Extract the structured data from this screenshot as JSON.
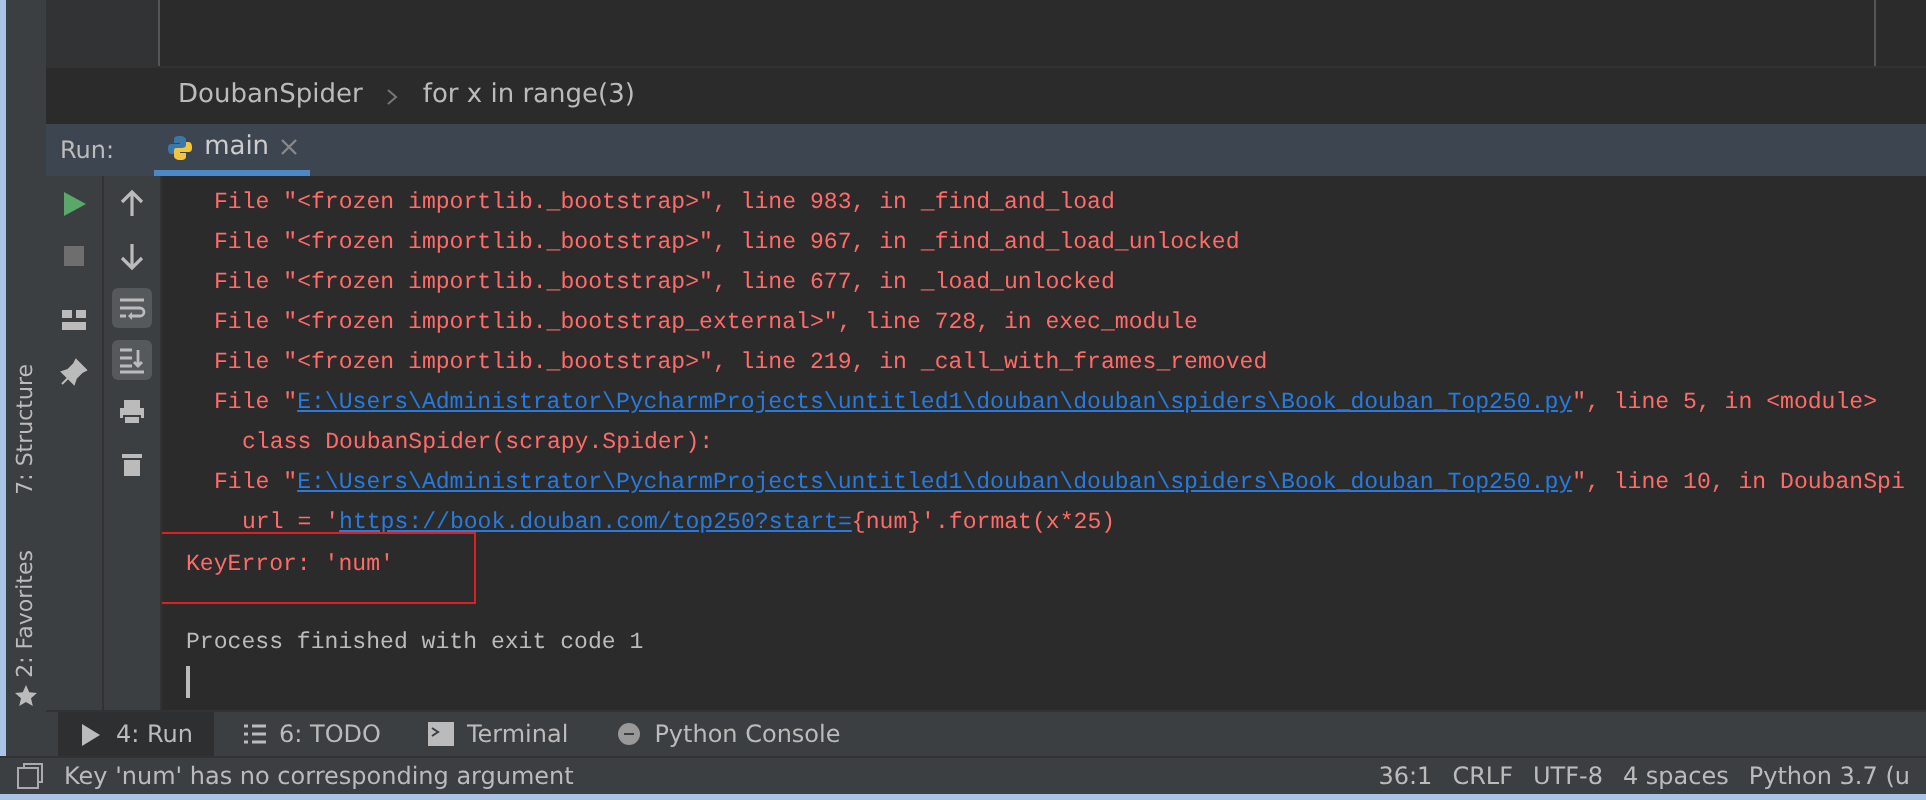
{
  "side_tabs": [
    {
      "label": "7: Structure"
    },
    {
      "label": "2: Favorites"
    }
  ],
  "breadcrumb": [
    {
      "label": "DoubanSpider"
    },
    {
      "label": "for x in range(3)"
    }
  ],
  "run_panel": {
    "title": "Run:",
    "tabs": [
      {
        "label": "main",
        "selected": true
      }
    ]
  },
  "toolbar_left": [
    {
      "kind": "run"
    },
    {
      "kind": "stop"
    },
    {
      "kind": "layout"
    },
    {
      "kind": "pin"
    }
  ],
  "toolbar_right": [
    {
      "kind": "up",
      "on": false
    },
    {
      "kind": "down",
      "on": false
    },
    {
      "kind": "wrap",
      "on": true
    },
    {
      "kind": "scroll-end",
      "on": true
    },
    {
      "kind": "print",
      "on": false
    },
    {
      "kind": "trash",
      "on": false
    }
  ],
  "console": [
    {
      "kind": "frame",
      "parts": [
        {
          "kind": "error",
          "text": "File \"<frozen importlib._bootstrap>\", line 983, in _find_and_load"
        }
      ]
    },
    {
      "kind": "frame",
      "parts": [
        {
          "kind": "error",
          "text": "File \"<frozen importlib._bootstrap>\", line 967, in _find_and_load_unlocked"
        }
      ]
    },
    {
      "kind": "frame",
      "parts": [
        {
          "kind": "error",
          "text": "File \"<frozen importlib._bootstrap>\", line 677, in _load_unlocked"
        }
      ]
    },
    {
      "kind": "frame",
      "parts": [
        {
          "kind": "error",
          "text": "File \"<frozen importlib._bootstrap_external>\", line 728, in exec_module"
        }
      ]
    },
    {
      "kind": "frame",
      "parts": [
        {
          "kind": "error",
          "text": "File \"<frozen importlib._bootstrap>\", line 219, in _call_with_frames_removed"
        }
      ]
    },
    {
      "kind": "frame",
      "parts": [
        {
          "kind": "error",
          "text": "File \""
        },
        {
          "kind": "link",
          "text": "E:\\Users\\Administrator\\PycharmProjects\\untitled1\\douban\\douban\\spiders\\Book_douban_Top250.py"
        },
        {
          "kind": "error",
          "text": "\", line 5, in <module>"
        }
      ]
    },
    {
      "kind": "source",
      "parts": [
        {
          "kind": "error",
          "text": "class DoubanSpider(scrapy.Spider):"
        }
      ]
    },
    {
      "kind": "frame",
      "parts": [
        {
          "kind": "error",
          "text": "File \""
        },
        {
          "kind": "link",
          "text": "E:\\Users\\Administrator\\PycharmProjects\\untitled1\\douban\\douban\\spiders\\Book_douban_Top250.py"
        },
        {
          "kind": "error",
          "text": "\", line 10, in DoubanSpi"
        }
      ]
    },
    {
      "kind": "source",
      "parts": [
        {
          "kind": "error",
          "text": "url = '"
        },
        {
          "kind": "link",
          "text": "https://book.douban.com/top250?start="
        },
        {
          "kind": "error",
          "text": "{num}'.format(x*25)"
        }
      ]
    },
    {
      "kind": "message",
      "highlighted": true,
      "parts": [
        {
          "kind": "error",
          "text": "KeyError: 'num'"
        }
      ]
    },
    {
      "kind": "blank"
    },
    {
      "kind": "message",
      "highlighted": false,
      "parts": [
        {
          "kind": "normal",
          "text": "Process finished with exit code 1"
        }
      ]
    }
  ],
  "bottom_tabs": [
    {
      "kind": "run",
      "label": "4: Run",
      "selected": true
    },
    {
      "kind": "todo",
      "label": "6: TODO",
      "selected": false
    },
    {
      "kind": "terminal",
      "label": "Terminal",
      "selected": false
    },
    {
      "kind": "console",
      "label": "Python Console",
      "selected": false
    }
  ],
  "status_bar": {
    "message": "Key 'num' has no corresponding argument",
    "items": [
      "36:1",
      "CRLF",
      "UTF-8",
      "4 spaces",
      "Python 3.7 (u"
    ]
  }
}
